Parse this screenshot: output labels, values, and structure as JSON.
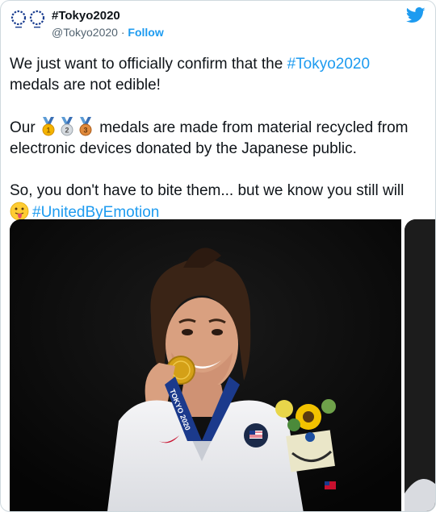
{
  "account": {
    "display_name": "#Tokyo2020",
    "handle": "@Tokyo2020",
    "separator": "·",
    "follow_label": "Follow"
  },
  "tweet": {
    "p1_prefix": "We just want to officially confirm that the ",
    "p1_hashtag": "#Tokyo2020",
    "p1_suffix": " medals are not edible!",
    "p2_prefix": "Our ",
    "p2_suffix": " medals are made from material recycled from electronic devices donated by the Japanese public.",
    "p3_text": "So, you don't have to bite them... but we know you still will ",
    "p3_hashtag": "#UnitedByEmotion"
  },
  "media": {
    "lanyard_text": "TOKYO 2020"
  },
  "icons": {
    "avatar": "tokyo-2020-emblems",
    "bird": "twitter-bird-icon",
    "medals": [
      "gold-medal-icon",
      "silver-medal-icon",
      "bronze-medal-icon"
    ],
    "emoji": "face-with-tongue-icon"
  },
  "colors": {
    "accent": "#1d9bf0",
    "text": "#0f1419",
    "muted": "#536471",
    "emblem": "#1a3d8f"
  }
}
